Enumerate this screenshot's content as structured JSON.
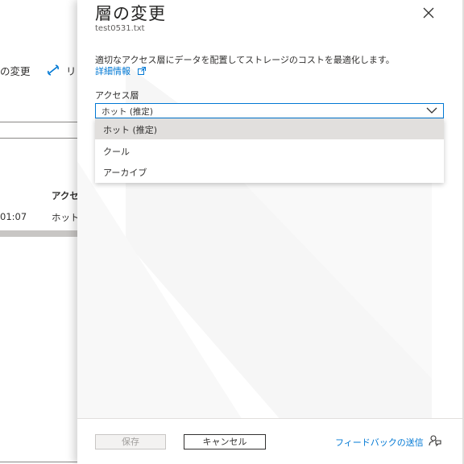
{
  "background_page": {
    "toolbar_change_tier": "の変更",
    "toolbar_rehydrate_prefix": "リ",
    "table_header_access": "アクセ",
    "row_time": "01:07",
    "row_tier": "ホット"
  },
  "panel": {
    "title": "層の変更",
    "subtitle": "test0531.txt",
    "description": "適切なアクセス層にデータを配置してストレージのコストを最適化します。",
    "learn_more_link": "詳細情報",
    "access_tier_label": "アクセス層",
    "access_tier_value": "ホット (推定)",
    "options": [
      {
        "label": "ホット (推定)",
        "selected": true
      },
      {
        "label": "クール",
        "selected": false
      },
      {
        "label": "アーカイブ",
        "selected": false
      }
    ]
  },
  "footer": {
    "save_label": "保存",
    "cancel_label": "キャンセル",
    "feedback_label": "フィードバックの送信"
  },
  "icons": {
    "close": "close-icon",
    "external_link": "external-link-icon",
    "chevron": "chevron-down-icon",
    "feedback": "feedback-icon",
    "rehydrate": "link-icon"
  },
  "colors": {
    "accent": "#0078d4",
    "selected_option": "#e1dfdd",
    "disabled_button": "#f3f2f1"
  }
}
